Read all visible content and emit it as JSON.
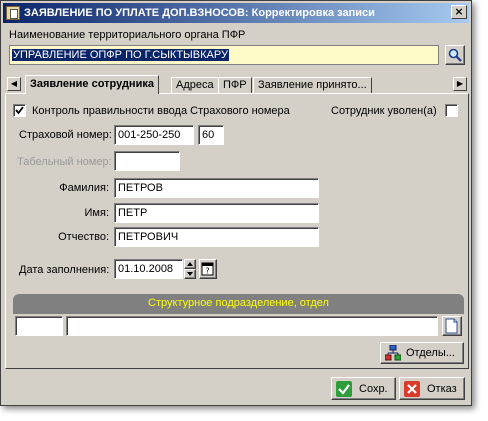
{
  "window": {
    "title": "ЗАЯВЛЕНИЕ ПО УПЛАТЕ ДОП.ВЗНОСОВ: Корректировка записи",
    "close_label": "×"
  },
  "org": {
    "label": "Наименование территориального органа ПФР",
    "value": "УПРАВЛЕНИЕ ОПФР ПО Г.СЫКТЫВКАРУ"
  },
  "tabs": [
    {
      "label": "Заявление сотрудника",
      "active": true
    },
    {
      "label": "Адреса"
    },
    {
      "label": "ПФР"
    },
    {
      "label": "Заявление принято..."
    }
  ],
  "form": {
    "control_check_label": "Контроль правильности ввода Страхового номера",
    "control_checked": true,
    "dismissed_label": "Сотрудник уволен(а)",
    "dismissed_checked": false,
    "insurance_label": "Страховой номер:",
    "insurance_value": "001-250-250",
    "insurance_suffix": "60",
    "tabel_label": "Табельный номер:",
    "tabel_value": "",
    "surname_label": "Фамилия:",
    "surname_value": "ПЕТРОВ",
    "name_label": "Имя:",
    "name_value": "ПЕТР",
    "patronymic_label": "Отчество:",
    "patronymic_value": "ПЕТРОВИЧ",
    "date_label": "Дата заполнения:",
    "date_value": "01.10.2008"
  },
  "department": {
    "header": "Структурное подразделение, отдел",
    "code_value": "",
    "name_value": "",
    "button_label": "Отделы..."
  },
  "footer": {
    "save_label": "Сохр.",
    "cancel_label": "Отказ"
  },
  "colors": {
    "title_gradient_start": "#0a246a",
    "title_gradient_end": "#a6caf0",
    "org_field_bg": "#fffbc8",
    "section_header_bg": "#808080",
    "section_header_text": "#ffff00",
    "save_icon": "#2e9e3a",
    "cancel_icon": "#d93a2a"
  },
  "icons": {
    "search": "magnifier-icon",
    "date_picker": "calendar-icon",
    "department": "org-chart-icon",
    "save": "checkmark-icon",
    "cancel": "cross-icon"
  }
}
